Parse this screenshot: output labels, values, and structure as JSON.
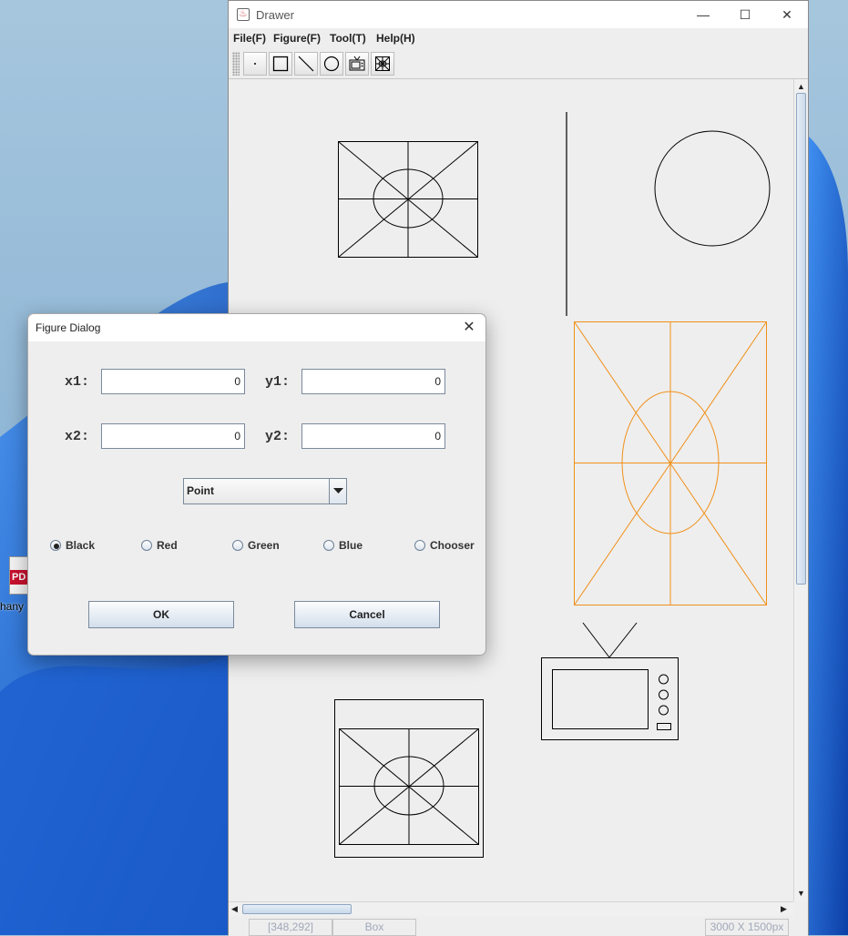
{
  "window": {
    "title": "Drawer",
    "controls": {
      "minimize": "—",
      "maximize": "☐",
      "close": "✕"
    }
  },
  "menubar": {
    "items": [
      "File(F)",
      "Figure(F)",
      "Tool(T)",
      "Help(H)"
    ]
  },
  "toolbar": {
    "tools": [
      "point-tool",
      "rectangle-tool",
      "line-tool",
      "circle-tool",
      "tv-tool",
      "box-tool"
    ]
  },
  "canvas": {
    "shapes": [
      "box",
      "line",
      "circle",
      "box",
      "tv",
      "box"
    ],
    "highlight_color": "#f0901a",
    "stroke_color": "#000000"
  },
  "statusbar": {
    "coords": "[348,292]",
    "mode": "Box",
    "size": "3000 X 1500px"
  },
  "desktop": {
    "icon_label": "hany",
    "icon_tag": "PD"
  },
  "dialog": {
    "title": "Figure Dialog",
    "close": "✕",
    "x1_label": "x1:",
    "y1_label": "y1:",
    "x2_label": "x2:",
    "y2_label": "y2:",
    "x1": "0",
    "y1": "0",
    "x2": "0",
    "y2": "0",
    "figure_type": "Point",
    "colors": [
      "Black",
      "Red",
      "Green",
      "Blue",
      "Chooser"
    ],
    "selected_color": "Black",
    "ok": "OK",
    "cancel": "Cancel"
  }
}
